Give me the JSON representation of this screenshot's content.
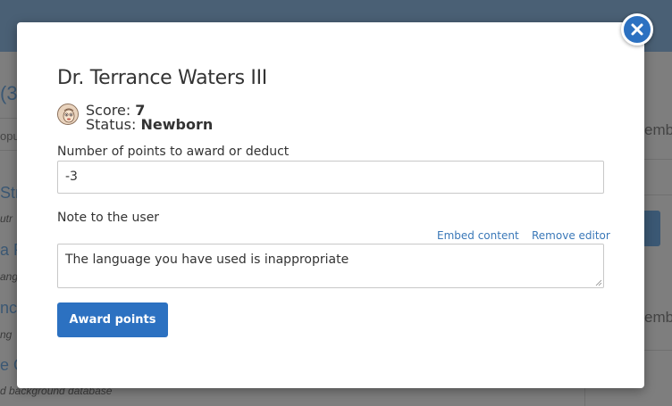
{
  "background": {
    "left_fragments": [
      "(3",
      "opu",
      "Str",
      "utr",
      "a P",
      "ang",
      "nc",
      "ng",
      "e G",
      "d background database"
    ],
    "right_fragments": [
      "emb",
      "emb"
    ]
  },
  "modal": {
    "title": "Dr. Terrance Waters III",
    "score_label": "Score:",
    "score_value": "7",
    "status_label": "Status:",
    "status_value": "Newborn",
    "points_label": "Number of points to award or deduct",
    "points_value": "-3",
    "note_label": "Note to the user",
    "embed_link": "Embed content",
    "remove_editor_link": "Remove editor",
    "note_value": "The language you have used is inappropriate",
    "award_button": "Award points"
  },
  "icons": {
    "close": "close-icon",
    "avatar": "user-avatar"
  },
  "colors": {
    "accent": "#2c71c1",
    "link": "#3a78b8",
    "overlay": "#7d7d7d"
  }
}
